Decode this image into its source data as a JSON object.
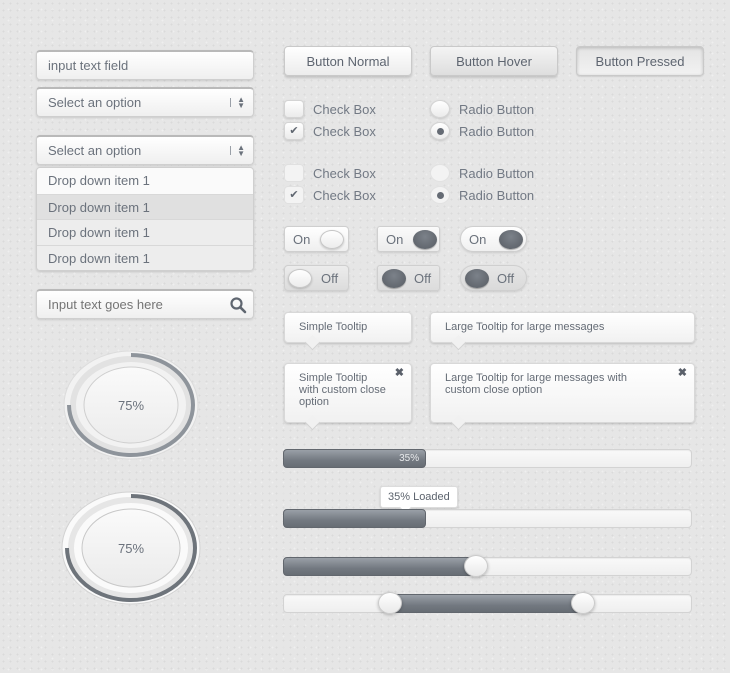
{
  "form": {
    "text_input": {
      "value": "input text field"
    },
    "select_closed": {
      "value": "Select an option"
    },
    "select_open": {
      "value": "Select an option",
      "items": [
        "Drop down item 1",
        "Drop down item 1",
        "Drop down item 1",
        "Drop down item 1"
      ]
    },
    "search": {
      "placeholder": "Input text goes here",
      "icon": "search-icon"
    }
  },
  "buttons": {
    "normal": "Button Normal",
    "hover": "Button Hover",
    "pressed": "Button Pressed"
  },
  "checkboxes": [
    {
      "label": "Check Box",
      "checked": false
    },
    {
      "label": "Check Box",
      "checked": true
    },
    {
      "label": "Check Box",
      "checked": false
    },
    {
      "label": "Check Box",
      "checked": true
    }
  ],
  "radios": [
    {
      "label": "Radio Button",
      "selected": false
    },
    {
      "label": "Radio Button",
      "selected": true
    },
    {
      "label": "Radio Button",
      "selected": false
    },
    {
      "label": "Radio Button",
      "selected": true
    }
  ],
  "check_glyph": "✔",
  "toggles": {
    "on_label": "On",
    "off_label": "Off"
  },
  "tooltips": {
    "simple": "Simple Tooltip",
    "large": "Large Tooltip for large messages",
    "simple_close": "Simple Tooltip with custom close option",
    "large_close": "Large Tooltip for large messages with custom close option",
    "close_glyph": "✖"
  },
  "progress": {
    "bar1": {
      "percent": 35,
      "label": "35%"
    },
    "bar2": {
      "percent": 35,
      "tooltip": "35% Loaded"
    },
    "slider": {
      "value_percent": 47
    },
    "range_slider": {
      "low_percent": 26,
      "high_percent": 73
    }
  },
  "circular_progress": [
    {
      "percent": 75,
      "label": "75%"
    },
    {
      "percent": 75,
      "label": "75%"
    }
  ]
}
